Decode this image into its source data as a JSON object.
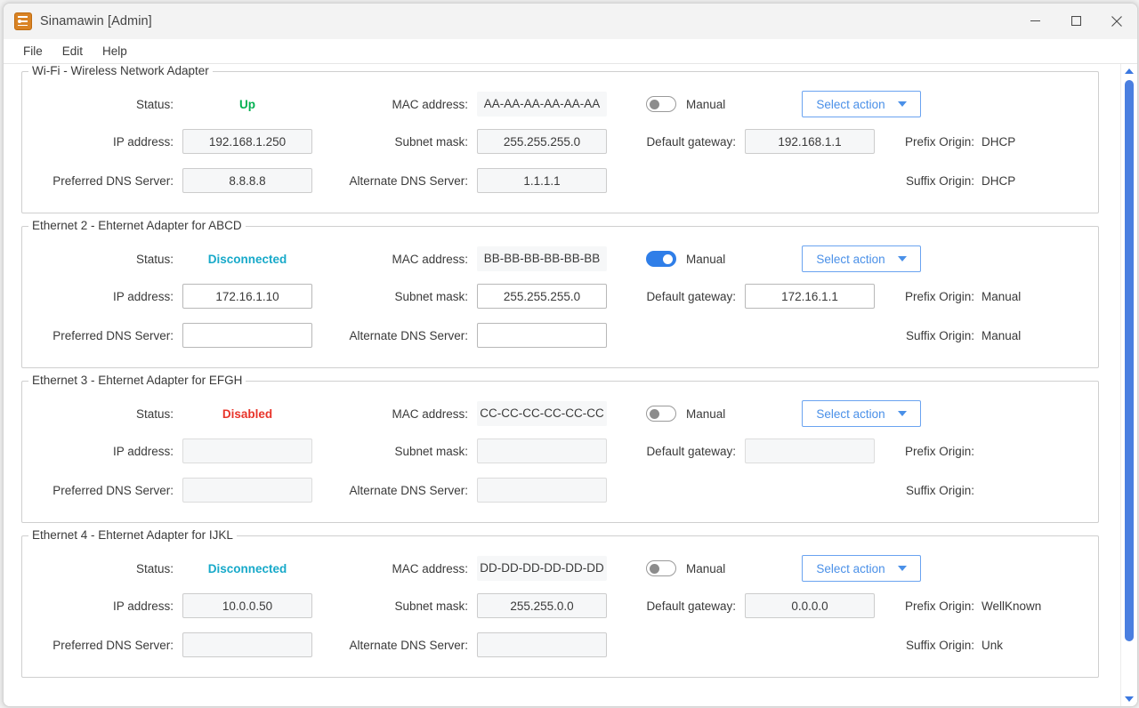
{
  "window": {
    "title": "Sinamawin [Admin]",
    "icon": "network-adapter-icon",
    "controls": {
      "minimize": "minimize-icon",
      "maximize": "maximize-icon",
      "close": "close-icon"
    }
  },
  "menubar": {
    "items": [
      "File",
      "Edit",
      "Help"
    ]
  },
  "labels": {
    "status": "Status:",
    "mac": "MAC address:",
    "manual": "Manual",
    "select_action": "Select action",
    "ip": "IP address:",
    "subnet": "Subnet mask:",
    "gateway": "Default gateway:",
    "prefix_origin": "Prefix Origin:",
    "preferred_dns": "Preferred DNS Server:",
    "alternate_dns": "Alternate DNS Server:",
    "suffix_origin": "Suffix Origin:"
  },
  "colors": {
    "status_up": "#00b050",
    "status_disconnected": "#17a9c9",
    "status_disabled": "#e8342a",
    "accent_blue": "#4a90e8",
    "toggle_on": "#2f7ee8",
    "scrollbar": "#4a7fe0"
  },
  "adapters": [
    {
      "title": "Wi-Fi - Wireless Network Adapter",
      "status": "Up",
      "status_color": "#00b050",
      "mac": "AA-AA-AA-AA-AA-AA",
      "manual_on": false,
      "action_label": "Select action",
      "ip": "192.168.1.250",
      "subnet": "255.255.255.0",
      "gateway": "192.168.1.1",
      "prefix_origin": "DHCP",
      "preferred_dns": "8.8.8.8",
      "alternate_dns": "1.1.1.1",
      "suffix_origin": "DHCP",
      "fields_enabled": false,
      "fields_blank": false
    },
    {
      "title": "Ethernet 2 - Ehternet Adapter for ABCD",
      "status": "Disconnected",
      "status_color": "#17a9c9",
      "mac": "BB-BB-BB-BB-BB-BB",
      "manual_on": true,
      "action_label": "Select action",
      "ip": "172.16.1.10",
      "subnet": "255.255.255.0",
      "gateway": "172.16.1.1",
      "prefix_origin": "Manual",
      "preferred_dns": "",
      "alternate_dns": "",
      "suffix_origin": "Manual",
      "fields_enabled": true,
      "fields_blank": false
    },
    {
      "title": "Ethernet 3 - Ehternet Adapter for EFGH",
      "status": "Disabled",
      "status_color": "#e8342a",
      "mac": "CC-CC-CC-CC-CC-CC",
      "manual_on": false,
      "action_label": "Select action",
      "ip": "",
      "subnet": "",
      "gateway": "",
      "prefix_origin": "",
      "preferred_dns": "",
      "alternate_dns": "",
      "suffix_origin": "",
      "fields_enabled": false,
      "fields_blank": true
    },
    {
      "title": "Ethernet 4 - Ehternet Adapter for IJKL",
      "status": "Disconnected",
      "status_color": "#17a9c9",
      "mac": "DD-DD-DD-DD-DD-DD",
      "manual_on": false,
      "action_label": "Select action",
      "ip": "10.0.0.50",
      "subnet": "255.255.0.0",
      "gateway": "0.0.0.0",
      "prefix_origin": "WellKnown",
      "preferred_dns": "",
      "alternate_dns": "",
      "suffix_origin": "Unk",
      "fields_enabled": false,
      "fields_blank": false
    }
  ],
  "scrollbar": {
    "up": "scroll-up-arrow",
    "down": "scroll-down-arrow",
    "thumb_percent": 92
  }
}
